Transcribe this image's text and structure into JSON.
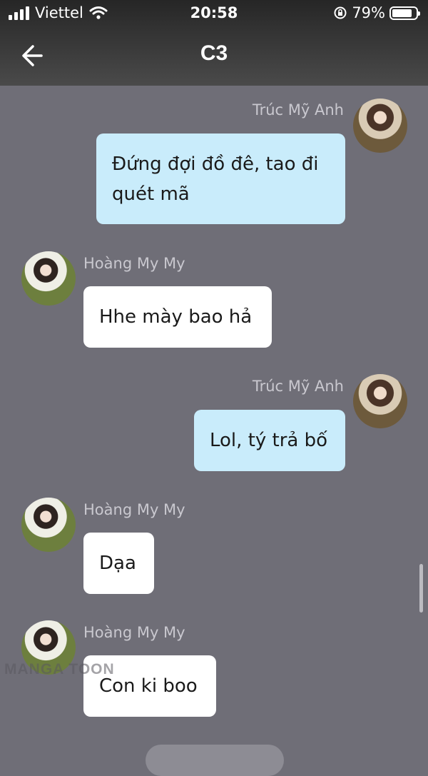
{
  "status_bar": {
    "carrier": "Viettel",
    "time": "20:58",
    "battery": "79%",
    "battery_level": 0.79
  },
  "header": {
    "title": "C3"
  },
  "messages": [
    {
      "sender": "Trúc Mỹ Anh",
      "text": "Đứng đợi đồ đê, tao đi quét mã",
      "side": "right"
    },
    {
      "sender": "Hoàng My My",
      "text": "Hhe mày bao hả",
      "side": "left"
    },
    {
      "sender": "Trúc Mỹ Anh",
      "text": "Lol, tý trả bố",
      "side": "right"
    },
    {
      "sender": "Hoàng My My",
      "text": "Dạa",
      "side": "left"
    },
    {
      "sender": "Hoàng My My",
      "text": "Con ki boo",
      "side": "left"
    }
  ],
  "watermark": "MANGA TOON",
  "colors": {
    "background": "#6f6e77",
    "my_bubble": "#c9ecfb",
    "their_bubble": "#ffffff",
    "sender_name": "#c9c8cf"
  }
}
